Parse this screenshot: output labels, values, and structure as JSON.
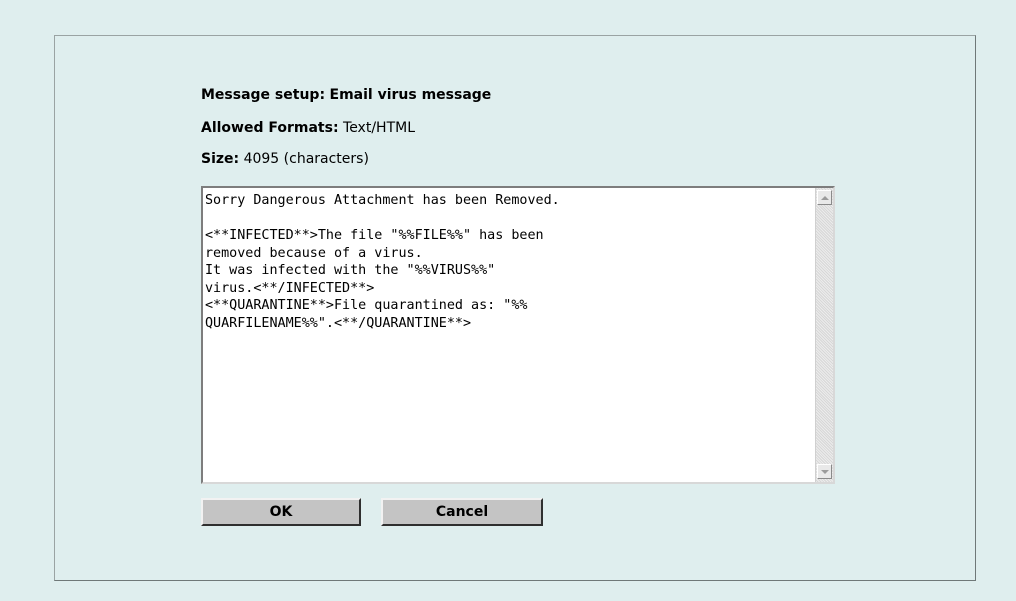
{
  "message_setup": {
    "label": "Message setup:",
    "value": "Email virus message"
  },
  "allowed_formats": {
    "label": "Allowed Formats:",
    "value": "Text/HTML"
  },
  "size": {
    "label": "Size:",
    "value": "4095 (characters)"
  },
  "message_body": "Sorry Dangerous Attachment has been Removed.\n\n<**INFECTED**>The file \"%%FILE%%\" has been\nremoved because of a virus.\nIt was infected with the \"%%VIRUS%%\"\nvirus.<**/INFECTED**>\n<**QUARANTINE**>File quarantined as: \"%%\nQUARFILENAME%%\".<**/QUARANTINE**>",
  "buttons": {
    "ok": "OK",
    "cancel": "Cancel"
  }
}
